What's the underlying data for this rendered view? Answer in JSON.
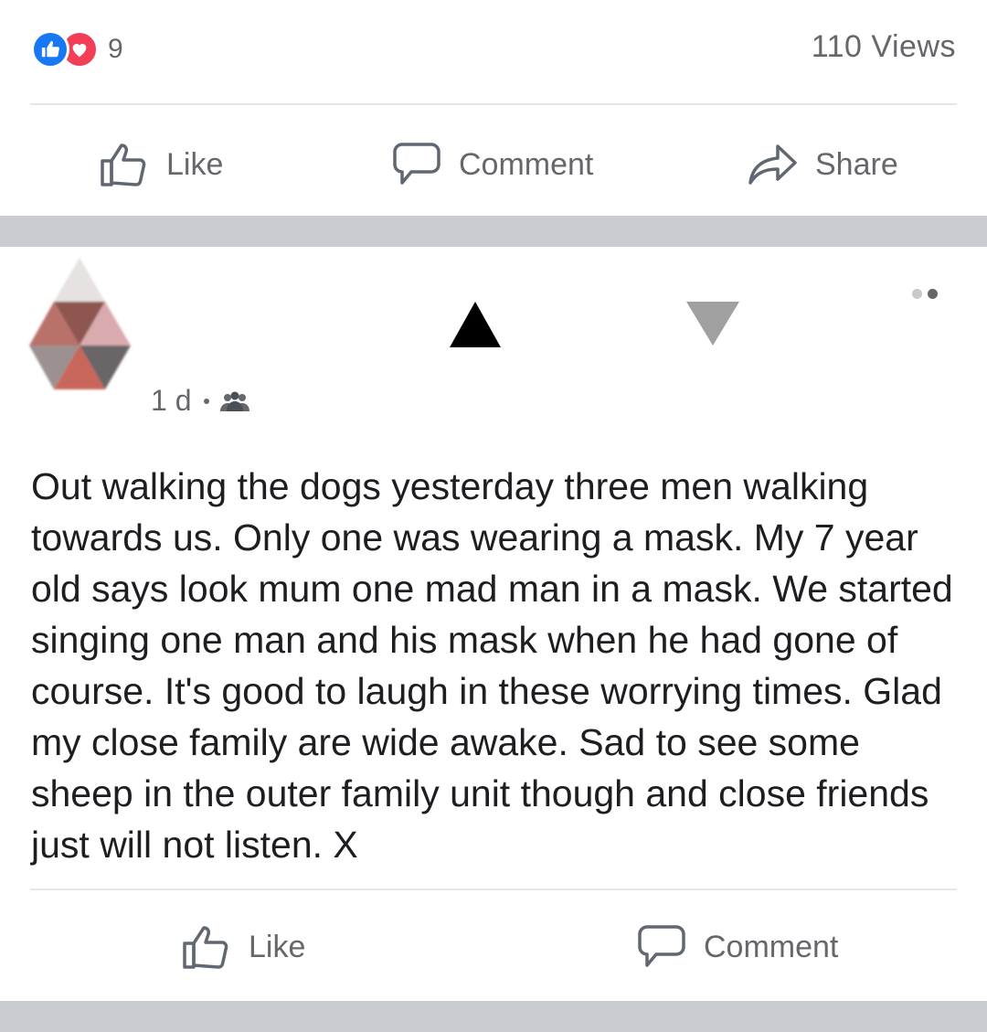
{
  "stats": {
    "reaction_count": "9",
    "views": "110 Views",
    "reaction_icons": [
      "like-reaction-icon",
      "love-reaction-icon"
    ]
  },
  "top_actions": {
    "like_label": "Like",
    "comment_label": "Comment",
    "share_label": "Share"
  },
  "post": {
    "timestamp": "1 d",
    "privacy_icon": "group-icon",
    "text": "Out walking the dogs yesterday three men walking towards us. Only one was wearing a mask. My 7 year old says look mum one mad man in a mask. We started singing one man and his mask when he had gone of course. It's good to laugh in these worrying times. Glad my close family are wide awake. Sad to see some sheep in the outer family unit though and close friends just will not listen. X"
  },
  "post_actions": {
    "like_label": "Like",
    "comment_label": "Comment"
  },
  "colors": {
    "like_blue": "#1877f2",
    "love_red": "#f33e58",
    "muted_text": "#65676b",
    "band_gray": "#c9ccd1"
  }
}
